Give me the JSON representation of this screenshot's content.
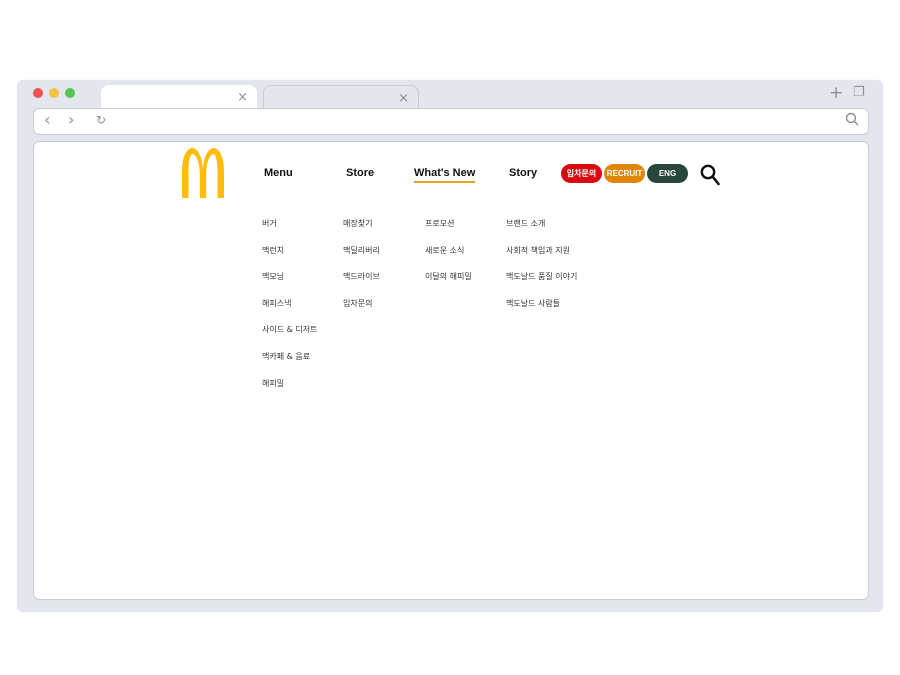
{
  "browser": {
    "tabs": [
      {
        "close_label": "×"
      },
      {
        "close_label": "×"
      }
    ],
    "controls": {
      "new_tab": "+",
      "restore": "❐"
    },
    "nav": {
      "back": "‹",
      "forward": "›",
      "reload": "↻"
    }
  },
  "site": {
    "brand_color": "#ffbc0d",
    "nav": {
      "menu": "Menu",
      "store": "Store",
      "whats_new": "What's New",
      "story": "Story"
    },
    "buttons": {
      "franchise": {
        "label": "입차문의",
        "color": "#da0a13"
      },
      "recruit": {
        "label": "RECRUIT",
        "color": "#e0870b"
      },
      "eng": {
        "label": "ENG",
        "color": "#28473a"
      }
    },
    "columns": {
      "menu": [
        "버거",
        "맥런치",
        "맥모닝",
        "해피스낵",
        "사이드 & 디저트",
        "맥카페 & 음료",
        "해피밀"
      ],
      "store": [
        "매장찾기",
        "맥딜리버리",
        "맥드라이브",
        "입차문의"
      ],
      "whats_new": [
        "프로모션",
        "새로운 소식",
        "이달의 해피밀"
      ],
      "story": [
        "브랜드 소개",
        "사회적 책임과 지원",
        "맥도날드 품질 이야기",
        "맥도날드 사람들"
      ]
    }
  }
}
